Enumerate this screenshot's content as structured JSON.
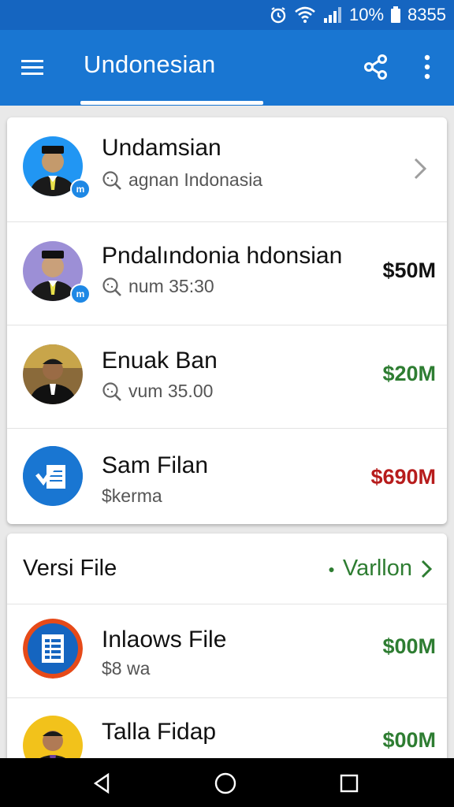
{
  "status_bar": {
    "battery": "10%",
    "time": "8355"
  },
  "app_bar": {
    "title": "Undonesian"
  },
  "card1": {
    "rows": [
      {
        "name": "Undamsian",
        "sub": "agnan Indonasia",
        "amount": "",
        "badge": "m"
      },
      {
        "name": "Pndalındonia hdonsian",
        "sub": "num 35:30",
        "amount": "$50M",
        "badge": "m"
      },
      {
        "name": "Enuak Ban",
        "sub": "vum 35.00",
        "amount": "$20M"
      },
      {
        "name": "Sam Filan",
        "sub": "$kerma",
        "amount": "$690M"
      }
    ]
  },
  "card2": {
    "title": "Versi File",
    "action": "Varllon",
    "rows": [
      {
        "name": "Inlaows File",
        "sub": "$8 wa",
        "amount": "$00M"
      },
      {
        "name": "Talla Fidap",
        "sub": "",
        "amount": "$00M"
      }
    ]
  },
  "colors": {
    "primary": "#1976d2",
    "status_bar": "#1565c0",
    "green": "#2e7d32",
    "red": "#b71c1c"
  },
  "icons": [
    "menu-icon",
    "share-icon",
    "more-icon",
    "search-icon",
    "chevron-right-icon",
    "back-icon",
    "home-icon",
    "recents-icon"
  ]
}
